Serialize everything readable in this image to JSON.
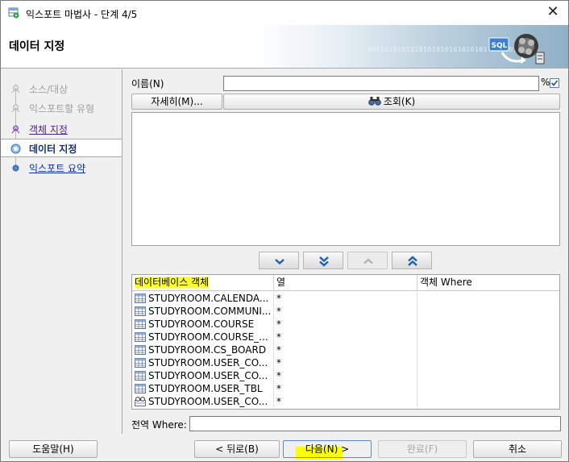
{
  "window": {
    "title": "익스포트 마법사 - 단계 4/5",
    "close_glyph": "✕"
  },
  "banner": {
    "title": "데이터 지정",
    "binary_text": "0001010101010101010101010101 01010101010"
  },
  "nav": {
    "items": [
      {
        "label": "소스/대상",
        "state": "disabled"
      },
      {
        "label": "익스포트할 유형",
        "state": "disabled"
      },
      {
        "label": "객체 지정",
        "state": "visited"
      },
      {
        "label": "데이터 지정",
        "state": "current"
      },
      {
        "label": "익스포트 요약",
        "state": "link"
      }
    ]
  },
  "filter": {
    "name_label": "이름(N)",
    "name_value": "",
    "percent": "%",
    "details_button": "자세히(M)...",
    "lookup_button": "조회(K)"
  },
  "table": {
    "headers": [
      "데이터베이스 객체",
      "열",
      "객체 Where"
    ],
    "rows": [
      {
        "object": "STUDYROOM.CALENDA...",
        "column": "*",
        "where": "",
        "icon": "table-icon"
      },
      {
        "object": "STUDYROOM.COMMUNI...",
        "column": "*",
        "where": "",
        "icon": "table-icon"
      },
      {
        "object": "STUDYROOM.COURSE",
        "column": "*",
        "where": "",
        "icon": "table-icon"
      },
      {
        "object": "STUDYROOM.COURSE_...",
        "column": "*",
        "where": "",
        "icon": "table-icon"
      },
      {
        "object": "STUDYROOM.CS_BOARD",
        "column": "*",
        "where": "",
        "icon": "table-icon"
      },
      {
        "object": "STUDYROOM.USER_CO...",
        "column": "*",
        "where": "",
        "icon": "table-icon"
      },
      {
        "object": "STUDYROOM.USER_CO...",
        "column": "*",
        "where": "",
        "icon": "table-icon"
      },
      {
        "object": "STUDYROOM.USER_TBL",
        "column": "*",
        "where": "",
        "icon": "table-icon"
      },
      {
        "object": "STUDYROOM.USER_CO...",
        "column": "*",
        "where": "",
        "icon": "view-icon"
      }
    ]
  },
  "global_where": {
    "label": "전역 Where:",
    "value": ""
  },
  "footer": {
    "help": "도움말(H)",
    "back": "< 뒤로(B)",
    "next": "다음(N) >",
    "finish": "완료(F)",
    "cancel": "취소"
  },
  "colors": {
    "highlight": "#ffff33",
    "link": "#0b2fa4",
    "visited_link": "#4b1f8f"
  }
}
